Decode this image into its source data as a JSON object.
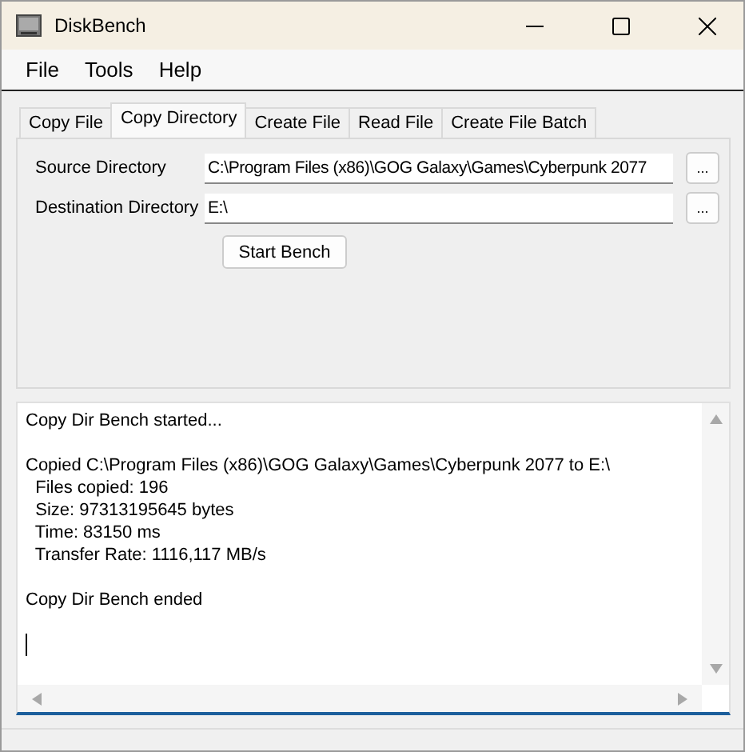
{
  "window": {
    "title": "DiskBench"
  },
  "menu": [
    "File",
    "Tools",
    "Help"
  ],
  "tabs": [
    {
      "label": "Copy File",
      "selected": false
    },
    {
      "label": "Copy Directory",
      "selected": true
    },
    {
      "label": "Create File",
      "selected": false
    },
    {
      "label": "Read File",
      "selected": false
    },
    {
      "label": "Create File Batch",
      "selected": false
    }
  ],
  "fields": [
    {
      "label": "Source Directory",
      "value": "C:\\Program Files (x86)\\GOG Galaxy\\Games\\Cyberpunk 2077",
      "browse": "..."
    },
    {
      "label": "Destination Directory",
      "value": "E:\\",
      "browse": "..."
    }
  ],
  "start_button": "Start Bench",
  "log": [
    [
      "Copy Dir Bench started..."
    ],
    [
      "Copied C:\\Program Files (x86)\\GOG Galaxy\\Games\\Cyberpunk 2077 to E:\\",
      "  Files copied: 196",
      "  Size: 97313195645 bytes",
      "  Time: 83150 ms",
      "  Transfer Rate: 1116,117 MB/s"
    ],
    [
      "Copy Dir Bench ended"
    ]
  ]
}
